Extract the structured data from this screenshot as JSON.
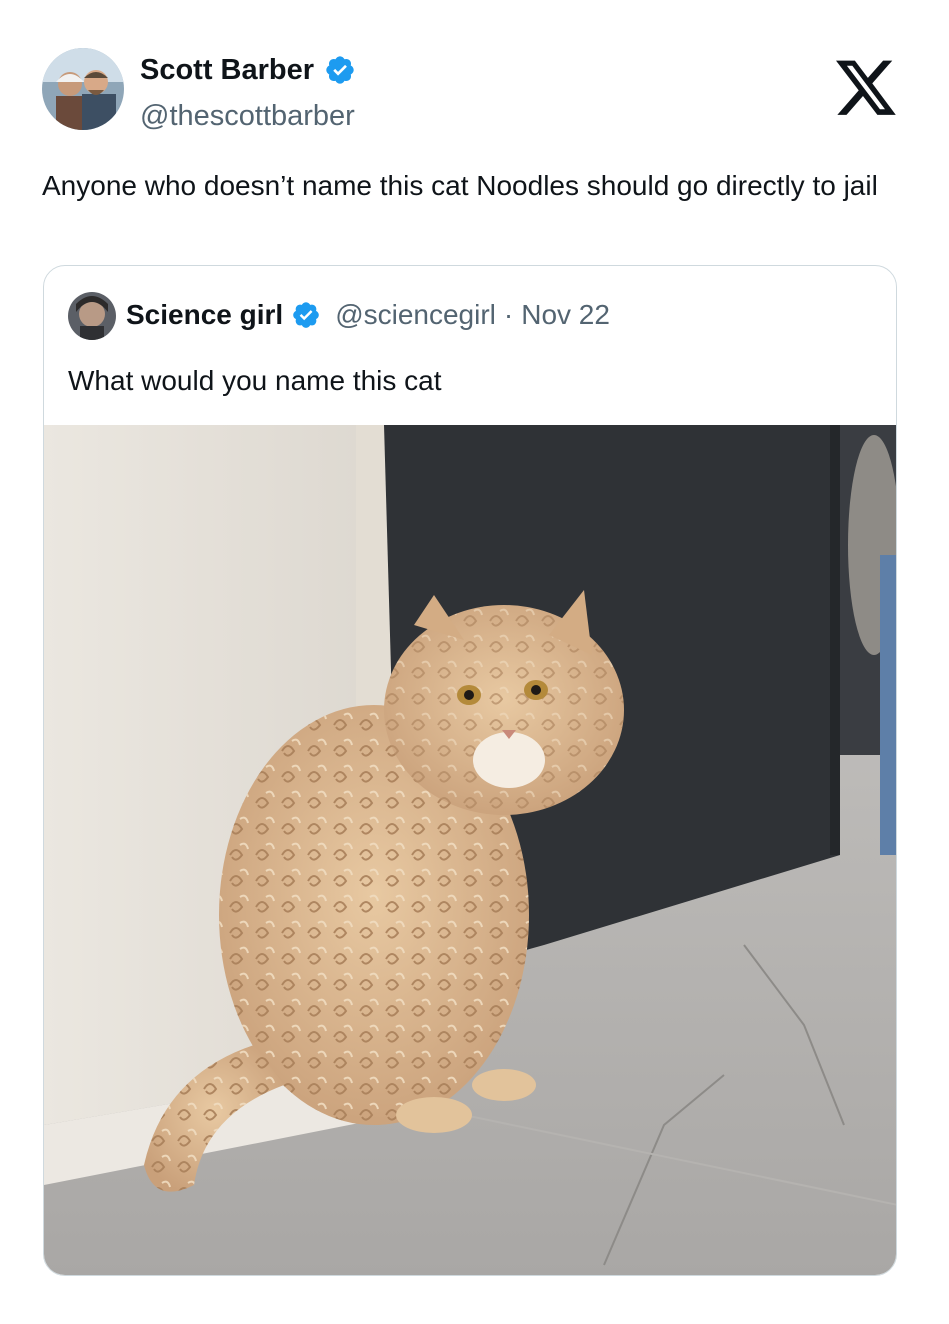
{
  "author": {
    "name": "Scott Barber",
    "handle": "@thescottbarber",
    "verified": true
  },
  "brand": {
    "logo": "x-logo-icon"
  },
  "tweet": {
    "text": "Anyone who doesn’t name this cat Noodles should go directly to jail"
  },
  "quoted_tweet": {
    "author_name": "Science girl",
    "handle": "@sciencegirl",
    "separator": "·",
    "date": "Nov 22",
    "verified": true,
    "text": "What would you name this cat",
    "media": "photo-curly-cat"
  },
  "colors": {
    "verified_blue": "#1d9bf0",
    "secondary_text": "#536471",
    "primary_text": "#0f1419",
    "border": "#cfd9de"
  }
}
